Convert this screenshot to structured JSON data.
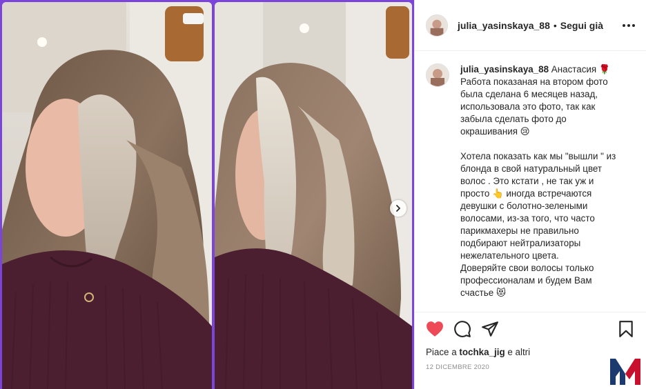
{
  "post": {
    "username": "julia_yasinskaya_88",
    "separator": "•",
    "follow_label": "Segui già",
    "caption_lines": [
      "Анастасия 🌹",
      "Работа показаная на втором фото",
      "была сделана 6 месяцев назад,",
      "использовала это фото, так как",
      "забыла сделать фото до",
      "окрашивания 😢"
    ],
    "caption_lines_2": [
      "Хотела показать как мы \"вышли \" из",
      "блонда в свой натуральный цвет",
      "волос . Это кстати , не так уж и",
      "просто 👆 иногда встречаются",
      "девушки с болотно-зелеными",
      "волосами, из-за того, что часто",
      "парикмахеры не правильно",
      "подбирают нейтрализаторы",
      "нежелательного цвета.",
      "Доверяйте свои волосы только",
      "профессионалам и будем Вам",
      "счастье 😻"
    ],
    "likes_prefix": "Piace a",
    "likes_user": "tochka_jig",
    "likes_suffix": "e altri",
    "date": "12 DICEMBRE 2020"
  },
  "icons": {
    "like": "heart-icon",
    "comment": "comment-icon",
    "share": "share-icon",
    "save": "bookmark-icon",
    "more": "more-icon",
    "next": "chevron-right-icon"
  },
  "colors": {
    "like_red": "#ed4956",
    "frame_purple": "#7a45d8",
    "text": "#262626",
    "muted": "#8e8e8e",
    "logo_red": "#c8102e",
    "logo_navy": "#1d3a6e"
  }
}
